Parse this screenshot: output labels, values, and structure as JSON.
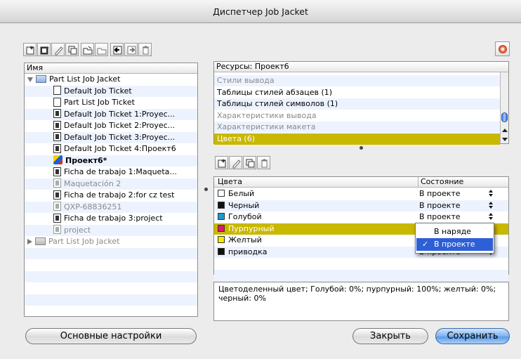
{
  "window": {
    "title": "Диспетчер Job Jacket"
  },
  "left_panel": {
    "header": "Имя",
    "items": [
      {
        "label": "Part List Job Jacket",
        "kind": "folder-open",
        "indent": 0,
        "style": ""
      },
      {
        "label": "Default Job Ticket",
        "kind": "doc",
        "indent": 1,
        "style": ""
      },
      {
        "label": "Part List Job Ticket",
        "kind": "doc",
        "indent": 1,
        "style": ""
      },
      {
        "label": "Default Job Ticket 1:Proyec...",
        "kind": "doc-dark",
        "indent": 1,
        "style": ""
      },
      {
        "label": "Default Job Ticket 2:Proyec...",
        "kind": "doc-dark",
        "indent": 1,
        "style": ""
      },
      {
        "label": "Default Job Ticket 3:Proyec...",
        "kind": "doc-dark",
        "indent": 1,
        "style": ""
      },
      {
        "label": "Default Job Ticket 4:Проект6",
        "kind": "doc-dark",
        "indent": 1,
        "style": ""
      },
      {
        "label": "Проект6*",
        "kind": "project",
        "indent": 1,
        "style": "bold"
      },
      {
        "label": "Ficha de trabajo 1:Maqueta...",
        "kind": "doc-dark",
        "indent": 1,
        "style": ""
      },
      {
        "label": "Maquetación 2",
        "kind": "ghost",
        "indent": 1,
        "style": "gray"
      },
      {
        "label": "Ficha de trabajo 2:for cz test",
        "kind": "doc-dark",
        "indent": 1,
        "style": ""
      },
      {
        "label": "QXP-68836251",
        "kind": "ghost",
        "indent": 1,
        "style": "gray"
      },
      {
        "label": "Ficha de trabajo 3:project",
        "kind": "doc-dark",
        "indent": 1,
        "style": ""
      },
      {
        "label": "project",
        "kind": "ghost",
        "indent": 1,
        "style": "gray"
      },
      {
        "label": "Part List Job Jacket",
        "kind": "folder-closed",
        "indent": 0,
        "style": "gray"
      }
    ]
  },
  "resources": {
    "header": "Ресурсы: Проект6",
    "items": [
      {
        "label": "Стили вывода",
        "style": "gray"
      },
      {
        "label": "Таблицы стилей абзацев (1)",
        "style": ""
      },
      {
        "label": "Таблицы стилей символов (1)",
        "style": ""
      },
      {
        "label": "Характеристики вывода",
        "style": "gray"
      },
      {
        "label": "Характеристики макета",
        "style": "gray"
      },
      {
        "label": "Цвета (6)",
        "style": "selected"
      }
    ]
  },
  "colors_table": {
    "headers": {
      "name": "Цвета",
      "status": "Состояние"
    },
    "rows": [
      {
        "name": "Белый",
        "swatch": "#ffffff",
        "status": "В проекте",
        "selected": false
      },
      {
        "name": "Черный",
        "swatch": "#111111",
        "status": "В проекте",
        "selected": false
      },
      {
        "name": "Голубой",
        "swatch": "#1a9ad8",
        "status": "В проекте",
        "selected": false
      },
      {
        "name": "Пурпурный",
        "swatch": "#e0167a",
        "status": "В проекте",
        "selected": true
      },
      {
        "name": "Желтый",
        "swatch": "#f6e800",
        "status": "В проекте",
        "selected": false
      },
      {
        "name": "приводка",
        "swatch": "#111111",
        "status": "В проекте",
        "selected": false
      }
    ]
  },
  "status_popup": {
    "options": [
      "В наряде",
      "В проекте"
    ],
    "selected": "В проекте",
    "check": "✓"
  },
  "description": "Цветоделенный цвет; Голубой: 0%; пурпурный: 100%; желтый: 0%; черный: 0%",
  "buttons": {
    "defaults": "Основные настройки",
    "close": "Закрыть",
    "save": "Сохранить"
  },
  "toolbar_icons": [
    "new-jacket-icon",
    "new-ticket-icon",
    "edit-icon",
    "duplicate-icon",
    "open-icon",
    "export-icon",
    "import-icon",
    "send-icon",
    "delete-icon"
  ],
  "resource_toolbar_icons": [
    "new-icon",
    "edit-icon",
    "duplicate-icon",
    "delete-icon"
  ]
}
